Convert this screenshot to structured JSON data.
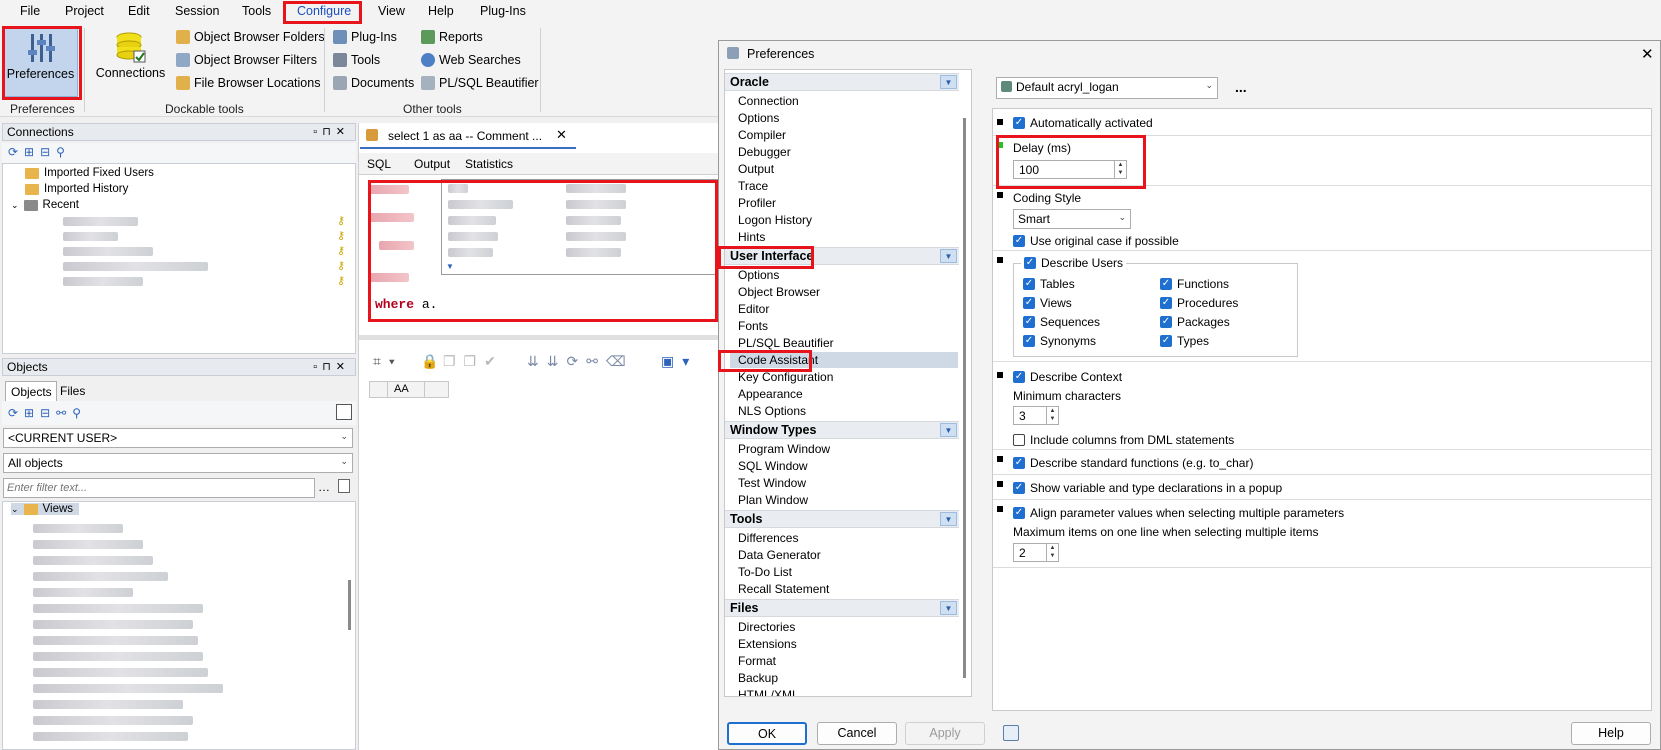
{
  "menubar": {
    "items": [
      "File",
      "Project",
      "Edit",
      "Session",
      "Tools",
      "Configure",
      "View",
      "Help",
      "Plug-Ins"
    ]
  },
  "ribbon": {
    "preferences_label": "Preferences",
    "connections_label": "Connections",
    "object_browser_folders": "Object Browser Folders",
    "object_browser_filters": "Object Browser Filters",
    "file_browser_locations": "File Browser Locations",
    "plug_ins": "Plug-Ins",
    "tools": "Tools",
    "documents": "Documents",
    "reports": "Reports",
    "web_searches": "Web Searches",
    "plsql_beautifier": "PL/SQL Beautifier",
    "group_preferences": "Preferences",
    "group_dockable": "Dockable tools",
    "group_other": "Other tools"
  },
  "connections_panel": {
    "title": "Connections",
    "items": [
      "Imported Fixed Users",
      "Imported History",
      "Recent"
    ]
  },
  "objects_panel": {
    "title": "Objects",
    "tabs": [
      "Objects",
      "Files"
    ],
    "user_combo": "<CURRENT USER>",
    "filter_combo": "All objects",
    "filter_placeholder": "Enter filter text...",
    "tree_root": "Views"
  },
  "editor": {
    "doc_tab": "select 1 as aa -- Comment ...",
    "sub_tabs": [
      "SQL",
      "Output",
      "Statistics"
    ],
    "code_keyword": "where",
    "code_rest": " a.",
    "grid_header": "AA"
  },
  "dialog": {
    "title": "Preferences",
    "close": "✕",
    "categories": [
      {
        "header": "Oracle",
        "items": [
          "Connection",
          "Options",
          "Compiler",
          "Debugger",
          "Output",
          "Trace",
          "Profiler",
          "Logon History",
          "Hints"
        ]
      },
      {
        "header": "User Interface",
        "items": [
          "Options",
          "Object Browser",
          "Editor",
          "Fonts",
          "PL/SQL Beautifier",
          "Code Assistant",
          "Key Configuration",
          "Appearance",
          "NLS Options"
        ]
      },
      {
        "header": "Window Types",
        "items": [
          "Program Window",
          "SQL Window",
          "Test Window",
          "Plan Window"
        ]
      },
      {
        "header": "Tools",
        "items": [
          "Differences",
          "Data Generator",
          "To-Do List",
          "Recall Statement"
        ]
      },
      {
        "header": "Files",
        "items": [
          "Directories",
          "Extensions",
          "Format",
          "Backup",
          "HTML/XML"
        ]
      }
    ],
    "profile": "Default acryl_logan",
    "more": "...",
    "settings": {
      "auto_activated": "Automatically activated",
      "delay_label": "Delay (ms)",
      "delay_value": "100",
      "coding_style_label": "Coding Style",
      "coding_style_value": "Smart",
      "original_case": "Use original case if possible",
      "describe_users": "Describe Users",
      "users_left": [
        "Tables",
        "Views",
        "Sequences",
        "Synonyms"
      ],
      "users_right": [
        "Functions",
        "Procedures",
        "Packages",
        "Types"
      ],
      "describe_context": "Describe Context",
      "min_chars_label": "Minimum characters",
      "min_chars_value": "3",
      "include_dml": "Include columns from DML statements",
      "describe_std": "Describe standard functions (e.g. to_char)",
      "show_var": "Show variable and type declarations in a popup",
      "align_params": "Align parameter values when selecting multiple parameters",
      "max_items_label": "Maximum items on one line when selecting multiple items",
      "max_items_value": "2"
    },
    "buttons": {
      "ok": "OK",
      "cancel": "Cancel",
      "apply": "Apply",
      "help": "Help"
    }
  }
}
